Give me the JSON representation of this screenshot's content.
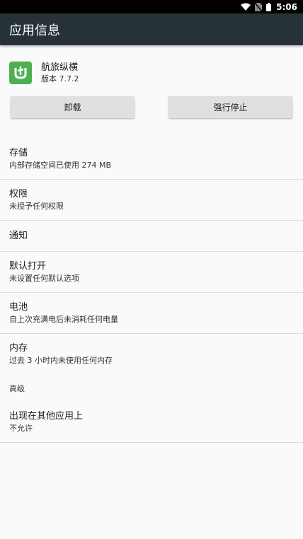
{
  "status_bar": {
    "time": "5:06",
    "icons": [
      "wifi-icon",
      "no-sim-icon",
      "battery-icon"
    ]
  },
  "app_bar": {
    "title": "应用信息"
  },
  "app": {
    "icon": "app-logo-icon",
    "name": "航旅纵横",
    "version": "版本 7.7.2",
    "accent_color": "#4caf50"
  },
  "buttons": {
    "uninstall": "卸载",
    "force_stop": "强行停止"
  },
  "items": [
    {
      "title": "存储",
      "subtitle": "内部存储空间已使用 274 MB"
    },
    {
      "title": "权限",
      "subtitle": "未授予任何权限"
    },
    {
      "title": "通知",
      "subtitle": ""
    },
    {
      "title": "默认打开",
      "subtitle": "未设置任何默认选项"
    },
    {
      "title": "电池",
      "subtitle": "自上次充满电后未消耗任何电量"
    },
    {
      "title": "内存",
      "subtitle": "过去 3 小时内未使用任何内存"
    }
  ],
  "advanced": {
    "label": "高级",
    "items": [
      {
        "title": "出现在其他应用上",
        "subtitle": "不允许"
      }
    ]
  }
}
